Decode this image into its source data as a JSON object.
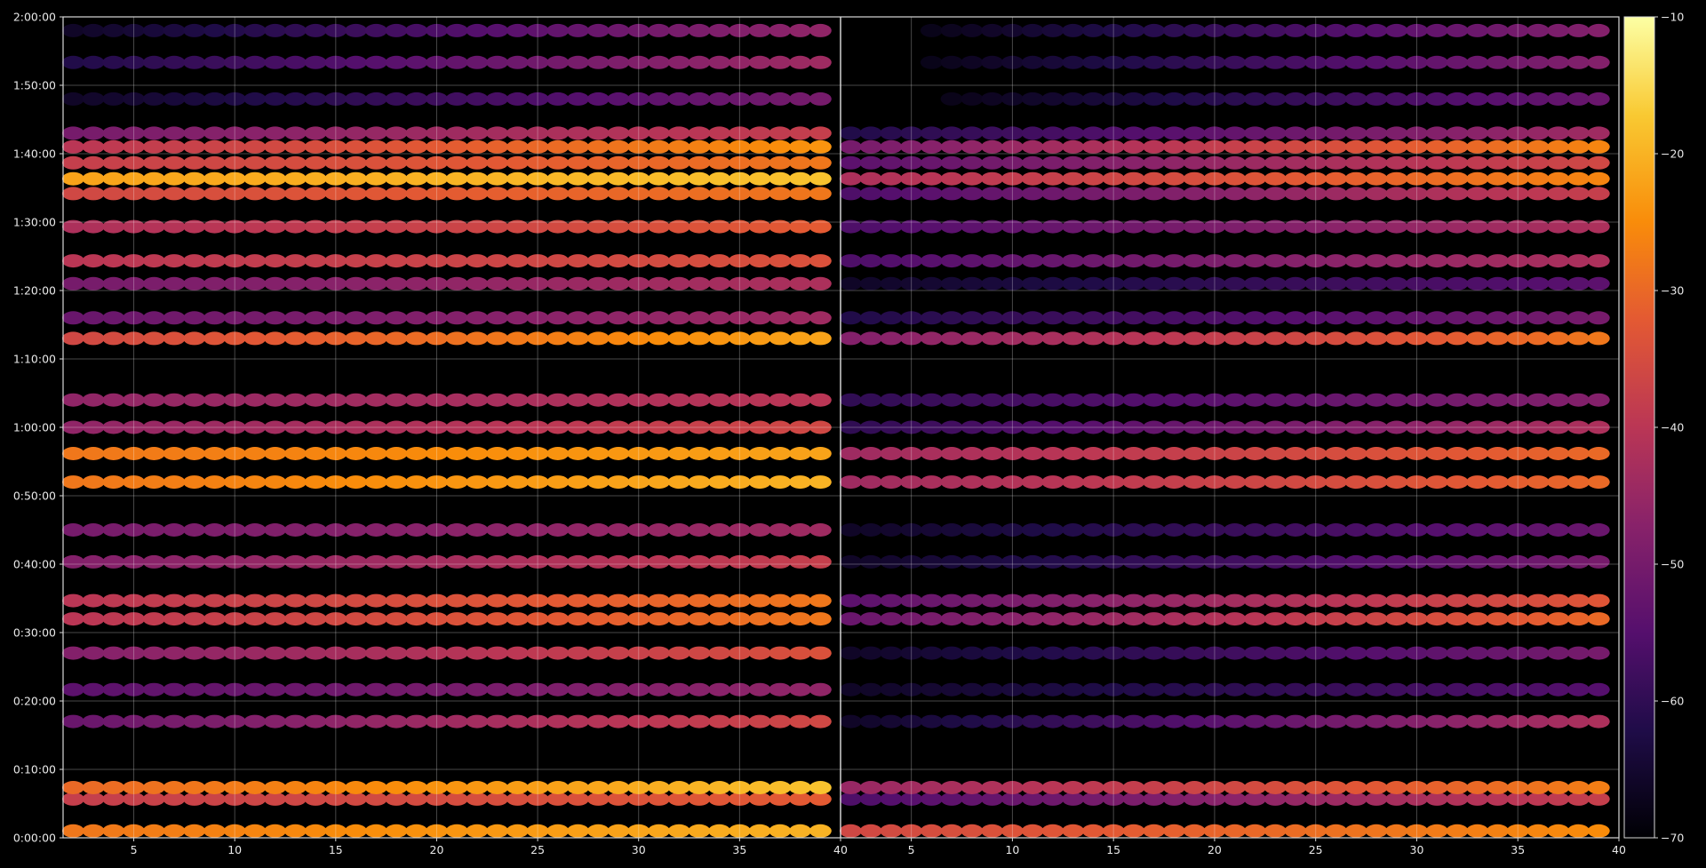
{
  "chart_data": {
    "type": "heatmap",
    "title": "",
    "xlabel": "",
    "ylabel": "",
    "panels": [
      {
        "name": "",
        "xlim": [
          1.5,
          40
        ]
      },
      {
        "name": "",
        "xlim": [
          1.5,
          40
        ]
      }
    ],
    "x_ticks": [
      "5",
      "10",
      "15",
      "20",
      "25",
      "30",
      "35",
      "40"
    ],
    "x_tick_values": [
      5,
      10,
      15,
      20,
      25,
      30,
      35,
      40
    ],
    "y_ticks": [
      "0:00:00",
      "0:10:00",
      "0:20:00",
      "0:30:00",
      "0:40:00",
      "0:50:00",
      "1:00:00",
      "1:10:00",
      "1:20:00",
      "1:30:00",
      "1:40:00",
      "1:50:00",
      "2:00:00"
    ],
    "y_tick_seconds": [
      0,
      600,
      1200,
      1800,
      2400,
      3000,
      3600,
      4200,
      4800,
      5400,
      6000,
      6600,
      7200
    ],
    "ylim_seconds": [
      0,
      7200
    ],
    "x_step": 1,
    "x_start": 2,
    "x_end": 39,
    "grid": true,
    "colorscale": "inferno",
    "colorbar": {
      "min": -70,
      "max": -10,
      "ticks": [
        "−10",
        "−20",
        "−30",
        "−40",
        "−50",
        "−60",
        "−70"
      ],
      "tick_values": [
        -10,
        -20,
        -30,
        -40,
        -50,
        -60,
        -70
      ]
    },
    "bands": [
      {
        "time_s": 60,
        "left": [
          -28,
          -20
        ],
        "right": [
          -36,
          -25
        ]
      },
      {
        "time_s": 340,
        "left": [
          -38,
          -32
        ],
        "right": [
          -56,
          -38
        ]
      },
      {
        "time_s": 440,
        "left": [
          -30,
          -18
        ],
        "right": [
          -45,
          -27
        ]
      },
      {
        "time_s": 1020,
        "left": [
          -52,
          -36
        ],
        "right": [
          -66,
          -42
        ]
      },
      {
        "time_s": 1300,
        "left": [
          -54,
          -46
        ],
        "right": [
          -66,
          -55
        ]
      },
      {
        "time_s": 1620,
        "left": [
          -48,
          -34
        ],
        "right": [
          -66,
          -50
        ]
      },
      {
        "time_s": 1920,
        "left": [
          -40,
          -28
        ],
        "right": [
          -52,
          -30
        ]
      },
      {
        "time_s": 2080,
        "left": [
          -40,
          -28
        ],
        "right": [
          -54,
          -33
        ]
      },
      {
        "time_s": 2420,
        "left": [
          -48,
          -38
        ],
        "right": [
          -66,
          -50
        ]
      },
      {
        "time_s": 2700,
        "left": [
          -50,
          -44
        ],
        "right": [
          -66,
          -52
        ]
      },
      {
        "time_s": 3120,
        "left": [
          -28,
          -20
        ],
        "right": [
          -44,
          -30
        ]
      },
      {
        "time_s": 3370,
        "left": [
          -28,
          -22
        ],
        "right": [
          -44,
          -30
        ]
      },
      {
        "time_s": 3600,
        "left": [
          -46,
          -36
        ],
        "right": [
          -60,
          -42
        ]
      },
      {
        "time_s": 3840,
        "left": [
          -46,
          -40
        ],
        "right": [
          -60,
          -48
        ]
      },
      {
        "time_s": 4380,
        "left": [
          -36,
          -22
        ],
        "right": [
          -48,
          -28
        ]
      },
      {
        "time_s": 4560,
        "left": [
          -52,
          -44
        ],
        "right": [
          -62,
          -50
        ]
      },
      {
        "time_s": 4860,
        "left": [
          -50,
          -42
        ],
        "right": [
          -66,
          -54
        ]
      },
      {
        "time_s": 5060,
        "left": [
          -40,
          -34
        ],
        "right": [
          -56,
          -42
        ]
      },
      {
        "time_s": 5360,
        "left": [
          -42,
          -32
        ],
        "right": [
          -56,
          -42
        ]
      },
      {
        "time_s": 5650,
        "left": [
          -36,
          -28
        ],
        "right": [
          -56,
          -38
        ]
      },
      {
        "time_s": 5780,
        "left": [
          -22,
          -18
        ],
        "right": [
          -42,
          -26
        ]
      },
      {
        "time_s": 5920,
        "left": [
          -38,
          -28
        ],
        "right": [
          -54,
          -36
        ]
      },
      {
        "time_s": 6060,
        "left": [
          -40,
          -24
        ],
        "right": [
          -50,
          -26
        ]
      },
      {
        "time_s": 6180,
        "left": [
          -50,
          -38
        ],
        "right": [
          -62,
          -44
        ]
      },
      {
        "time_s": 6480,
        "left": [
          -66,
          -50
        ],
        "right": [
          -70,
          -52
        ]
      },
      {
        "time_s": 6800,
        "left": [
          -62,
          -44
        ],
        "right": [
          -70,
          -48
        ]
      },
      {
        "time_s": 7080,
        "left": [
          -66,
          -46
        ],
        "right": [
          -70,
          -48
        ]
      }
    ]
  }
}
